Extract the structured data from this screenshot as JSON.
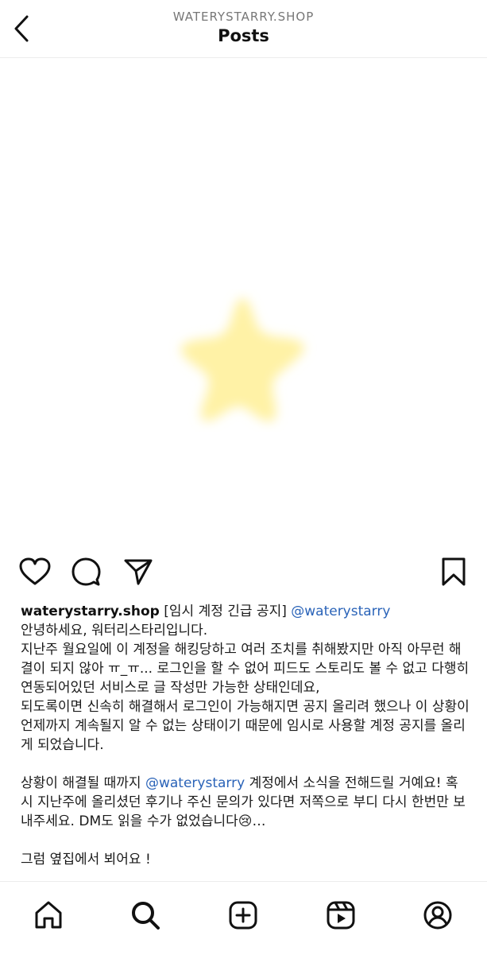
{
  "header": {
    "username": "WATERYSTARRY.SHOP",
    "title": "Posts"
  },
  "icons": {
    "back": "back-arrow-icon",
    "like": "heart-icon",
    "comment": "comment-icon",
    "share": "send-icon",
    "save": "bookmark-icon",
    "tabs": [
      "home-icon",
      "search-icon",
      "create-icon",
      "reels-icon",
      "profile-icon"
    ]
  },
  "post": {
    "image": {
      "description_color": "#fdf3a8"
    },
    "caption": {
      "username": "waterystarry.shop",
      "headline": " [임시 계정 긴급 공지] ",
      "headline_mention": "@waterystarry",
      "line1": "안녕하세요, 워터리스타리입니다.",
      "para1": "지난주 월요일에 이 계정을 해킹당하고 여러 조치를 취해봤지만 아직 아무런 해결이 되지 않아 ㅠ_ㅠ... 로그인을 할 수 없어 피드도 스토리도 볼 수 없고 다행히 연동되어있던 서비스로 글 작성만 가능한 상태인데요,",
      "para2": "되도록이면 신속히 해결해서 로그인이 가능해지면 공지 올리려 했으나 이 상황이 언제까지 계속될지 알 수 없는 상태이기 때문에  임시로 사용할 계정 공지를 올리게 되었습니다.",
      "para3_a": "상황이 해결될 때까지 ",
      "para3_mention": "@waterystarry",
      "para3_b": " 계정에서 소식을 전해드릴 거예요! 혹시 지난주에 올리셨던 후기나 주신 문의가 있다면 저쪽으로 부디 다시 한번만 보내주세요. DM도 읽을 수가 없었습니다",
      "para3_emoji": "😢",
      "para3_more": "…",
      "closing": "그럼 옆집에서 뵈어요 !"
    }
  },
  "colors": {
    "mention": "#2a63b8",
    "star": "#fff2a6"
  }
}
